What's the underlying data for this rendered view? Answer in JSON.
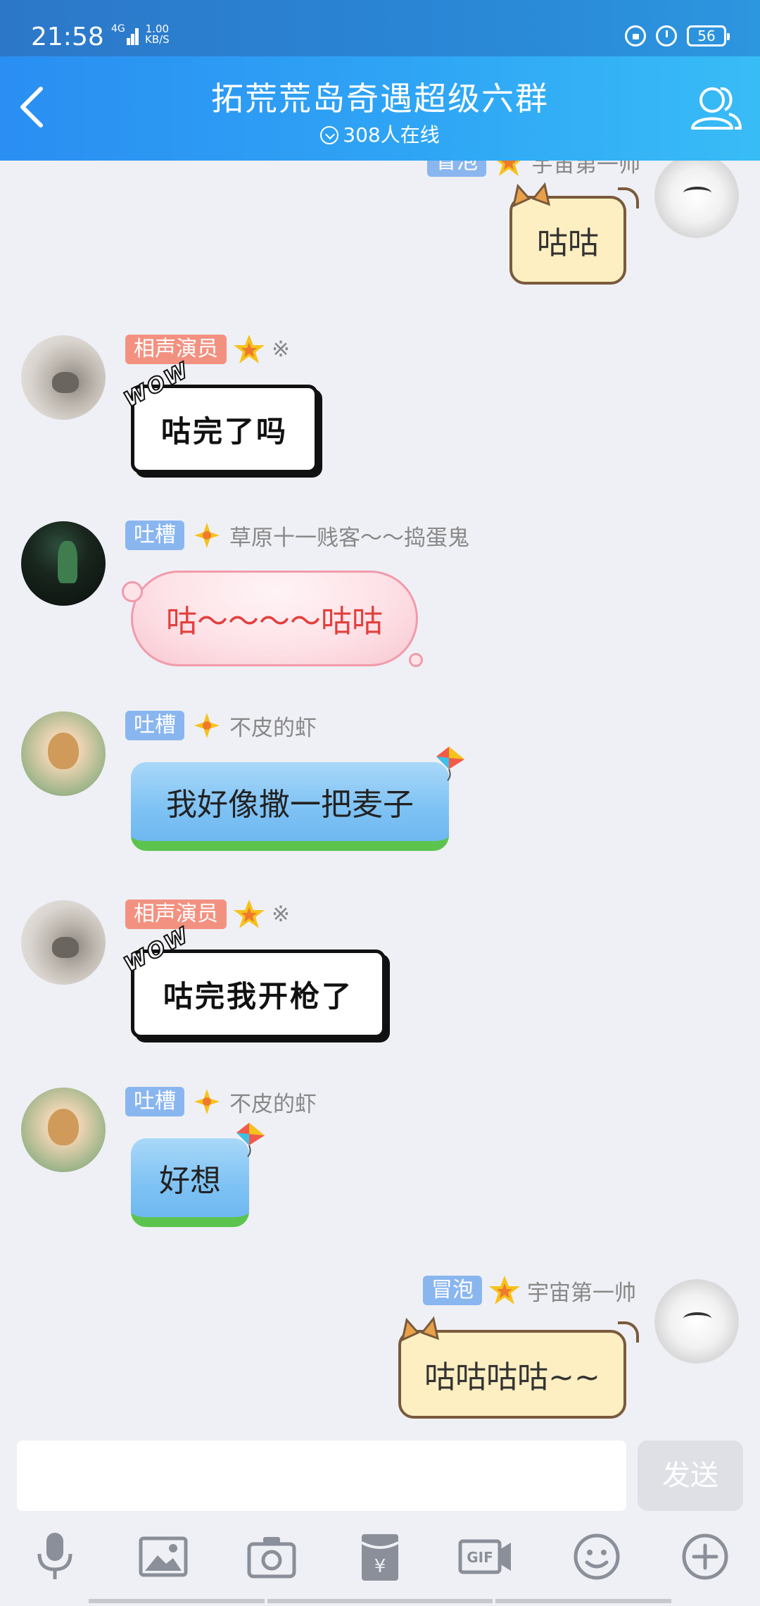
{
  "status_bar": {
    "time": "21:58",
    "network": "4G",
    "speed_value": "1.00",
    "speed_unit": "KB/S",
    "battery": "56"
  },
  "header": {
    "title": "拓荒荒岛奇遇超级六群",
    "online": "308人在线"
  },
  "messages": [
    {
      "side": "right",
      "badge": "冒泡",
      "nickname": "宇宙第一帅",
      "text": "咕咕",
      "style": "cat"
    },
    {
      "side": "left",
      "badge": "相声演员",
      "nickname": "※",
      "text": "咕完了吗",
      "style": "wow"
    },
    {
      "side": "left",
      "badge": "吐槽",
      "nickname": "草原十一贱客～～捣蛋鬼",
      "text": "咕～～～～咕咕",
      "style": "pink"
    },
    {
      "side": "left",
      "badge": "吐槽",
      "nickname": "不皮的虾",
      "text": "我好像撒一把麦子",
      "style": "blue"
    },
    {
      "side": "left",
      "badge": "相声演员",
      "nickname": "※",
      "text": "咕完我开枪了",
      "style": "wow"
    },
    {
      "side": "left",
      "badge": "吐槽",
      "nickname": "不皮的虾",
      "text": "好想",
      "style": "blue"
    },
    {
      "side": "right",
      "badge": "冒泡",
      "nickname": "宇宙第一帅",
      "text": "咕咕咕咕~~",
      "style": "cat"
    }
  ],
  "wow_label": "WOW",
  "input": {
    "value": "",
    "send_label": "发送"
  },
  "toolbar": [
    "mic-icon",
    "image-icon",
    "camera-icon",
    "red-packet-icon",
    "gif-icon",
    "emoji-icon",
    "plus-icon"
  ],
  "colors": {
    "header_start": "#2a8ef2",
    "header_end": "#38bcf6",
    "badge_red": "#f39181",
    "badge_blue": "#8ab6f0",
    "background": "#eff0f5"
  }
}
